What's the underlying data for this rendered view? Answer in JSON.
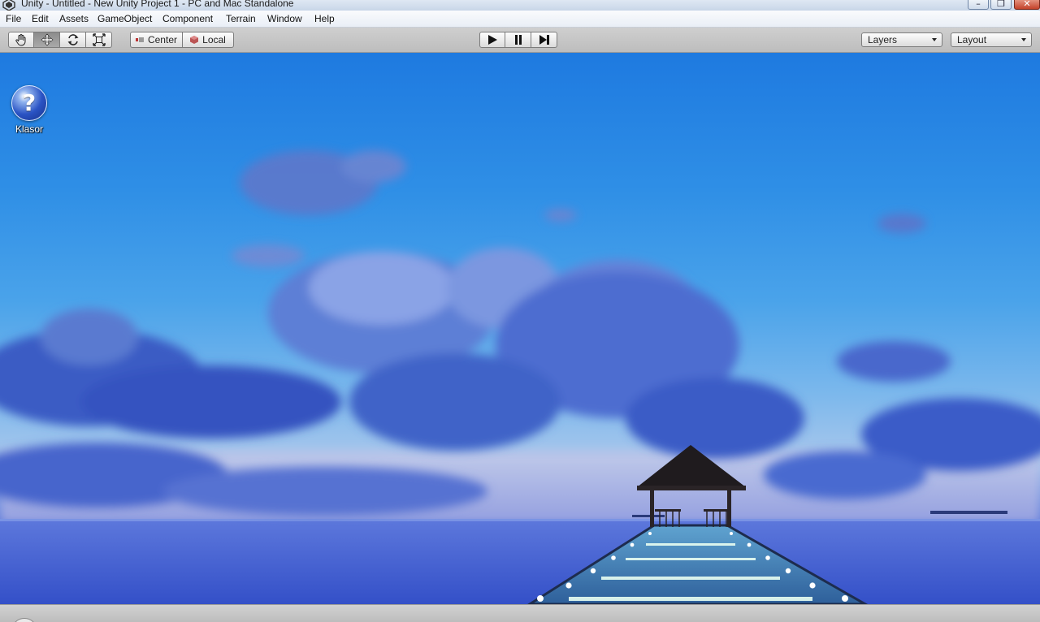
{
  "window": {
    "title": "Unity - Untitled - New Unity Project 1 - PC and Mac Standalone",
    "controls": {
      "minimize": "–",
      "maximize": "❐",
      "close": "✕"
    }
  },
  "menu": [
    "File",
    "Edit",
    "Assets",
    "GameObject",
    "Component",
    "Terrain",
    "Window",
    "Help"
  ],
  "toolbar": {
    "transform_tools": [
      {
        "name": "hand-tool",
        "icon": "hand-icon",
        "active": false
      },
      {
        "name": "move-tool",
        "icon": "move-icon",
        "active": true
      },
      {
        "name": "rotate-tool",
        "icon": "rotate-icon",
        "active": false
      },
      {
        "name": "scale-tool",
        "icon": "scale-icon",
        "active": false
      }
    ],
    "pivot": {
      "center_label": "Center",
      "local_label": "Local"
    },
    "playback": {
      "play": "play-icon",
      "pause": "pause-icon",
      "step": "step-icon"
    },
    "layers_label": "Layers",
    "layout_label": "Layout"
  },
  "desktop": {
    "icon_label": "Klasor",
    "icon_glyph": "?"
  },
  "colors": {
    "sky_top": "#1e7ae0",
    "sea": "#3f5fd2",
    "toolbar": "#c4c4c4"
  }
}
